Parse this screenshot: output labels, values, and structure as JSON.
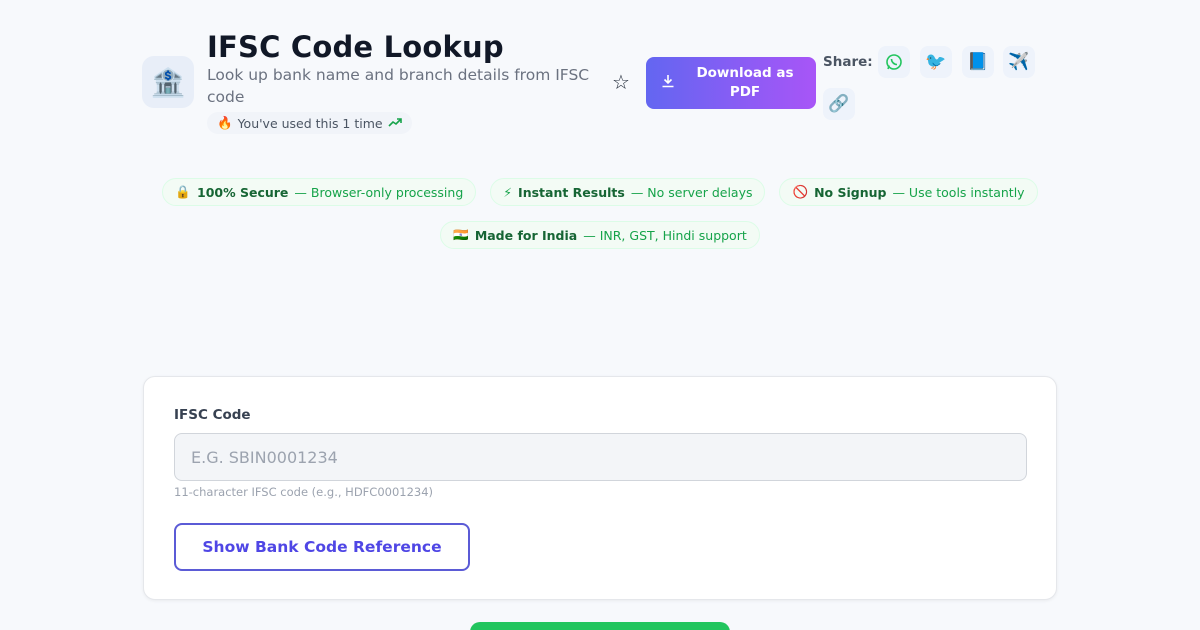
{
  "header": {
    "app_icon": "bank-icon",
    "title": "IFSC Code Lookup",
    "subtitle": "Look up bank name and branch details from IFSC code",
    "usage": {
      "fire_icon": "🔥",
      "text": "You've used this 1 time",
      "trend_icon": "trending-up-icon"
    }
  },
  "actions": {
    "favorite_icon": "star-icon",
    "download_label": "Download as PDF",
    "share_label": "Share:",
    "share_buttons": [
      {
        "name": "whatsapp",
        "icon": "whatsapp-icon"
      },
      {
        "name": "twitter",
        "icon": "twitter-icon"
      },
      {
        "name": "facebook",
        "icon": "facebook-icon"
      },
      {
        "name": "telegram",
        "icon": "telegram-icon"
      },
      {
        "name": "copy-link",
        "icon": "link-icon"
      }
    ]
  },
  "badges": [
    {
      "icon": "🔒",
      "title": "100% Secure",
      "desc": "— Browser-only processing"
    },
    {
      "icon": "⚡",
      "title": "Instant Results",
      "desc": "— No server delays"
    },
    {
      "icon": "🚫",
      "title": "No Signup",
      "desc": "— Use tools instantly"
    },
    {
      "icon": "🇮🇳",
      "title": "Made for India",
      "desc": "— INR, GST, Hindi support"
    }
  ],
  "form": {
    "ifsc_label": "IFSC Code",
    "ifsc_placeholder": "E.G. SBIN0001234",
    "ifsc_value": "",
    "ifsc_hint": "11-character IFSC code (e.g., HDFC0001234)",
    "reference_button": "Show Bank Code Reference"
  },
  "colors": {
    "accent": "#4f46e5",
    "gradient_start": "#6366f1",
    "gradient_end": "#a855f7",
    "success": "#22c55e"
  }
}
